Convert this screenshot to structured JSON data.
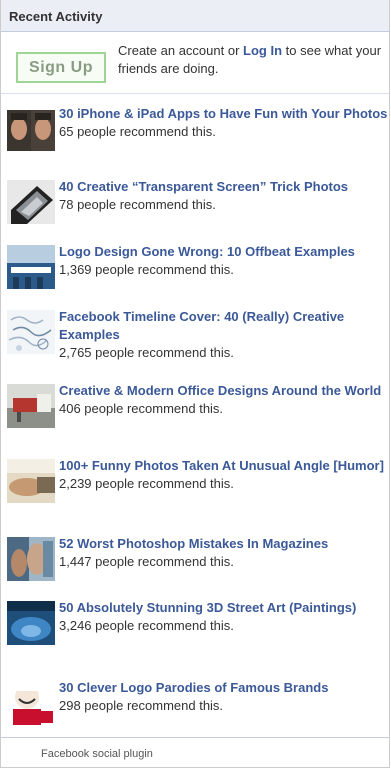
{
  "header": {
    "title": "Recent Activity"
  },
  "signup": {
    "button_label": "Sign Up",
    "text_before": "Create an account or ",
    "login_link": "Log In",
    "text_after": " to see what your friends are doing."
  },
  "items": [
    {
      "title": "30 iPhone & iPad Apps to Have Fun with Your Photos",
      "count": "65 people recommend this.",
      "thumb_icon": "faces-photo-thumb"
    },
    {
      "title": "40 Creative “Transparent Screen” Trick Photos",
      "count": "78 people recommend this.",
      "thumb_icon": "tablet-photo-thumb"
    },
    {
      "title": "Logo Design Gone Wrong: 10 Offbeat Examples",
      "count": "1,369 people recommend this.",
      "thumb_icon": "building-sign-thumb"
    },
    {
      "title": "Facebook Timeline Cover: 40 (Really) Creative Examples",
      "count": "2,765 people recommend this.",
      "thumb_icon": "sketch-cover-thumb"
    },
    {
      "title": "Creative & Modern Office Designs Around the World",
      "count": "406 people recommend this.",
      "thumb_icon": "office-thumb"
    },
    {
      "title": "100+ Funny Photos Taken At Unusual Angle [Humor]",
      "count": "2,239 people recommend this.",
      "thumb_icon": "hand-photo-thumb"
    },
    {
      "title": "52 Worst Photoshop Mistakes In Magazines",
      "count": "1,447 people recommend this.",
      "thumb_icon": "magazine-thumb"
    },
    {
      "title": "50 Absolutely Stunning 3D Street Art (Paintings)",
      "count": "3,246 people recommend this.",
      "thumb_icon": "street-art-thumb"
    },
    {
      "title": "30 Clever Logo Parodies of Famous Brands",
      "count": "298 people recommend this.",
      "thumb_icon": "kfc-logo-thumb"
    }
  ],
  "footer": {
    "text": "Facebook social plugin"
  }
}
